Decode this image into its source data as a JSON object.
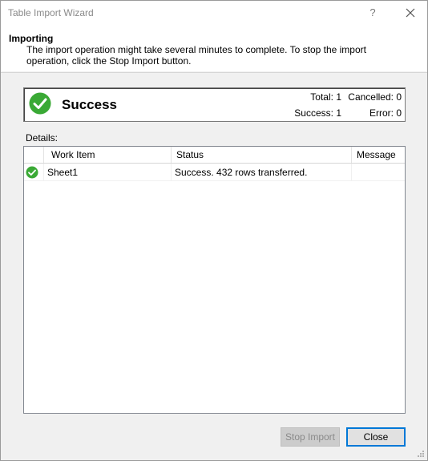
{
  "window": {
    "title": "Table Import Wizard",
    "help_glyph": "?"
  },
  "header": {
    "title": "Importing",
    "description": "The import operation might take several minutes to complete. To stop the import operation, click the Stop Import button."
  },
  "status": {
    "label": "Success",
    "icon": "success-check-icon",
    "total_text": "Total: 1",
    "cancelled_text": "Cancelled: 0",
    "success_text": "Success: 1",
    "error_text": "Error: 0",
    "accent_color": "#3aa935"
  },
  "details": {
    "label": "Details:",
    "columns": [
      "Work Item",
      "Status",
      "Message"
    ],
    "rows": [
      {
        "icon": "success-check-icon",
        "work_item": "Sheet1",
        "status": "Success. 432 rows transferred.",
        "message": ""
      }
    ]
  },
  "buttons": {
    "stop_import": "Stop Import",
    "close": "Close"
  }
}
